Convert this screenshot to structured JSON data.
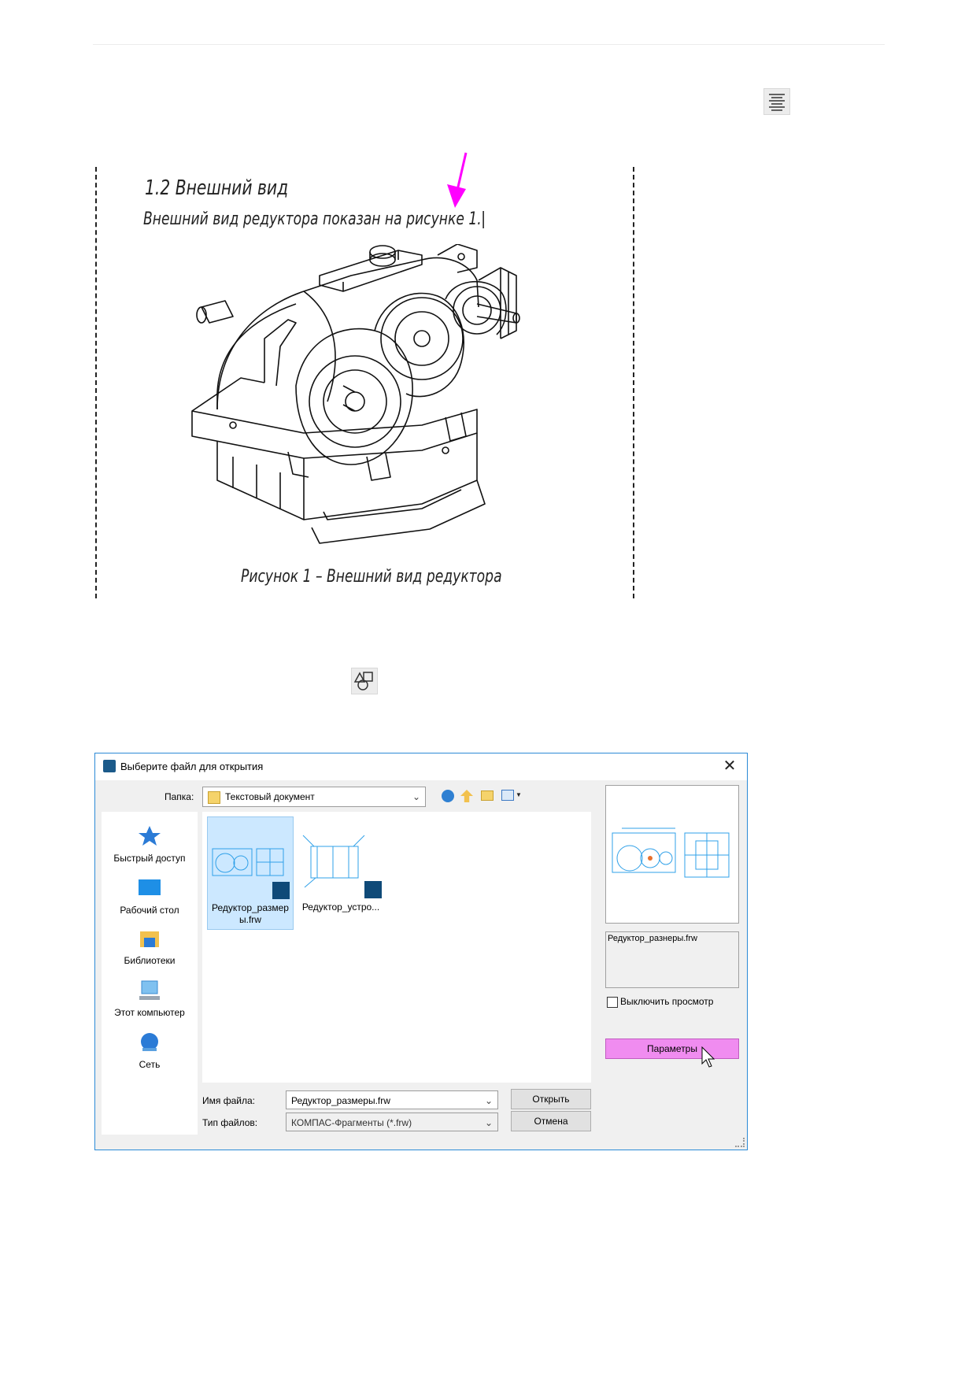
{
  "document": {
    "heading": "1.2  Внешний вид",
    "body_line": "Внешний вид редуктора показан на рисунке 1.",
    "caption": "Рисунок 1 – Внешний вид редуктора"
  },
  "icons": {
    "align_button": "align-center-icon",
    "insert_fragment_button": "insert-fragment-icon",
    "arrow_color": "#ff00ff"
  },
  "dialog": {
    "title": "Выберите файл для открытия",
    "folder_label": "Папка:",
    "folder_value": "Текстовый документ",
    "places": [
      {
        "label": "Быстрый доступ",
        "icon": "star-icon"
      },
      {
        "label": "Рабочий стол",
        "icon": "desktop-icon"
      },
      {
        "label": "Библиотеки",
        "icon": "library-icon"
      },
      {
        "label": "Этот компьютер",
        "icon": "computer-icon"
      },
      {
        "label": "Сеть",
        "icon": "network-icon"
      }
    ],
    "files": [
      {
        "name": "Редуктор_размеры.frw",
        "selected": true
      },
      {
        "name": "Редуктор_устро..."
      }
    ],
    "preview_filename": "Редуктор_разнеры.frw",
    "disable_preview_label": "Выключить просмотр",
    "params_button": "Параметры",
    "filename_label": "Имя файла:",
    "filename_value": "Редуктор_размеры.frw",
    "filetype_label": "Тип файлов:",
    "filetype_value": "КОМПАС-Фрагменты (*.frw)",
    "open_button": "Открыть",
    "cancel_button": "Отмена",
    "accent_color": "#f08cf0",
    "selection_color": "#cce8ff"
  }
}
